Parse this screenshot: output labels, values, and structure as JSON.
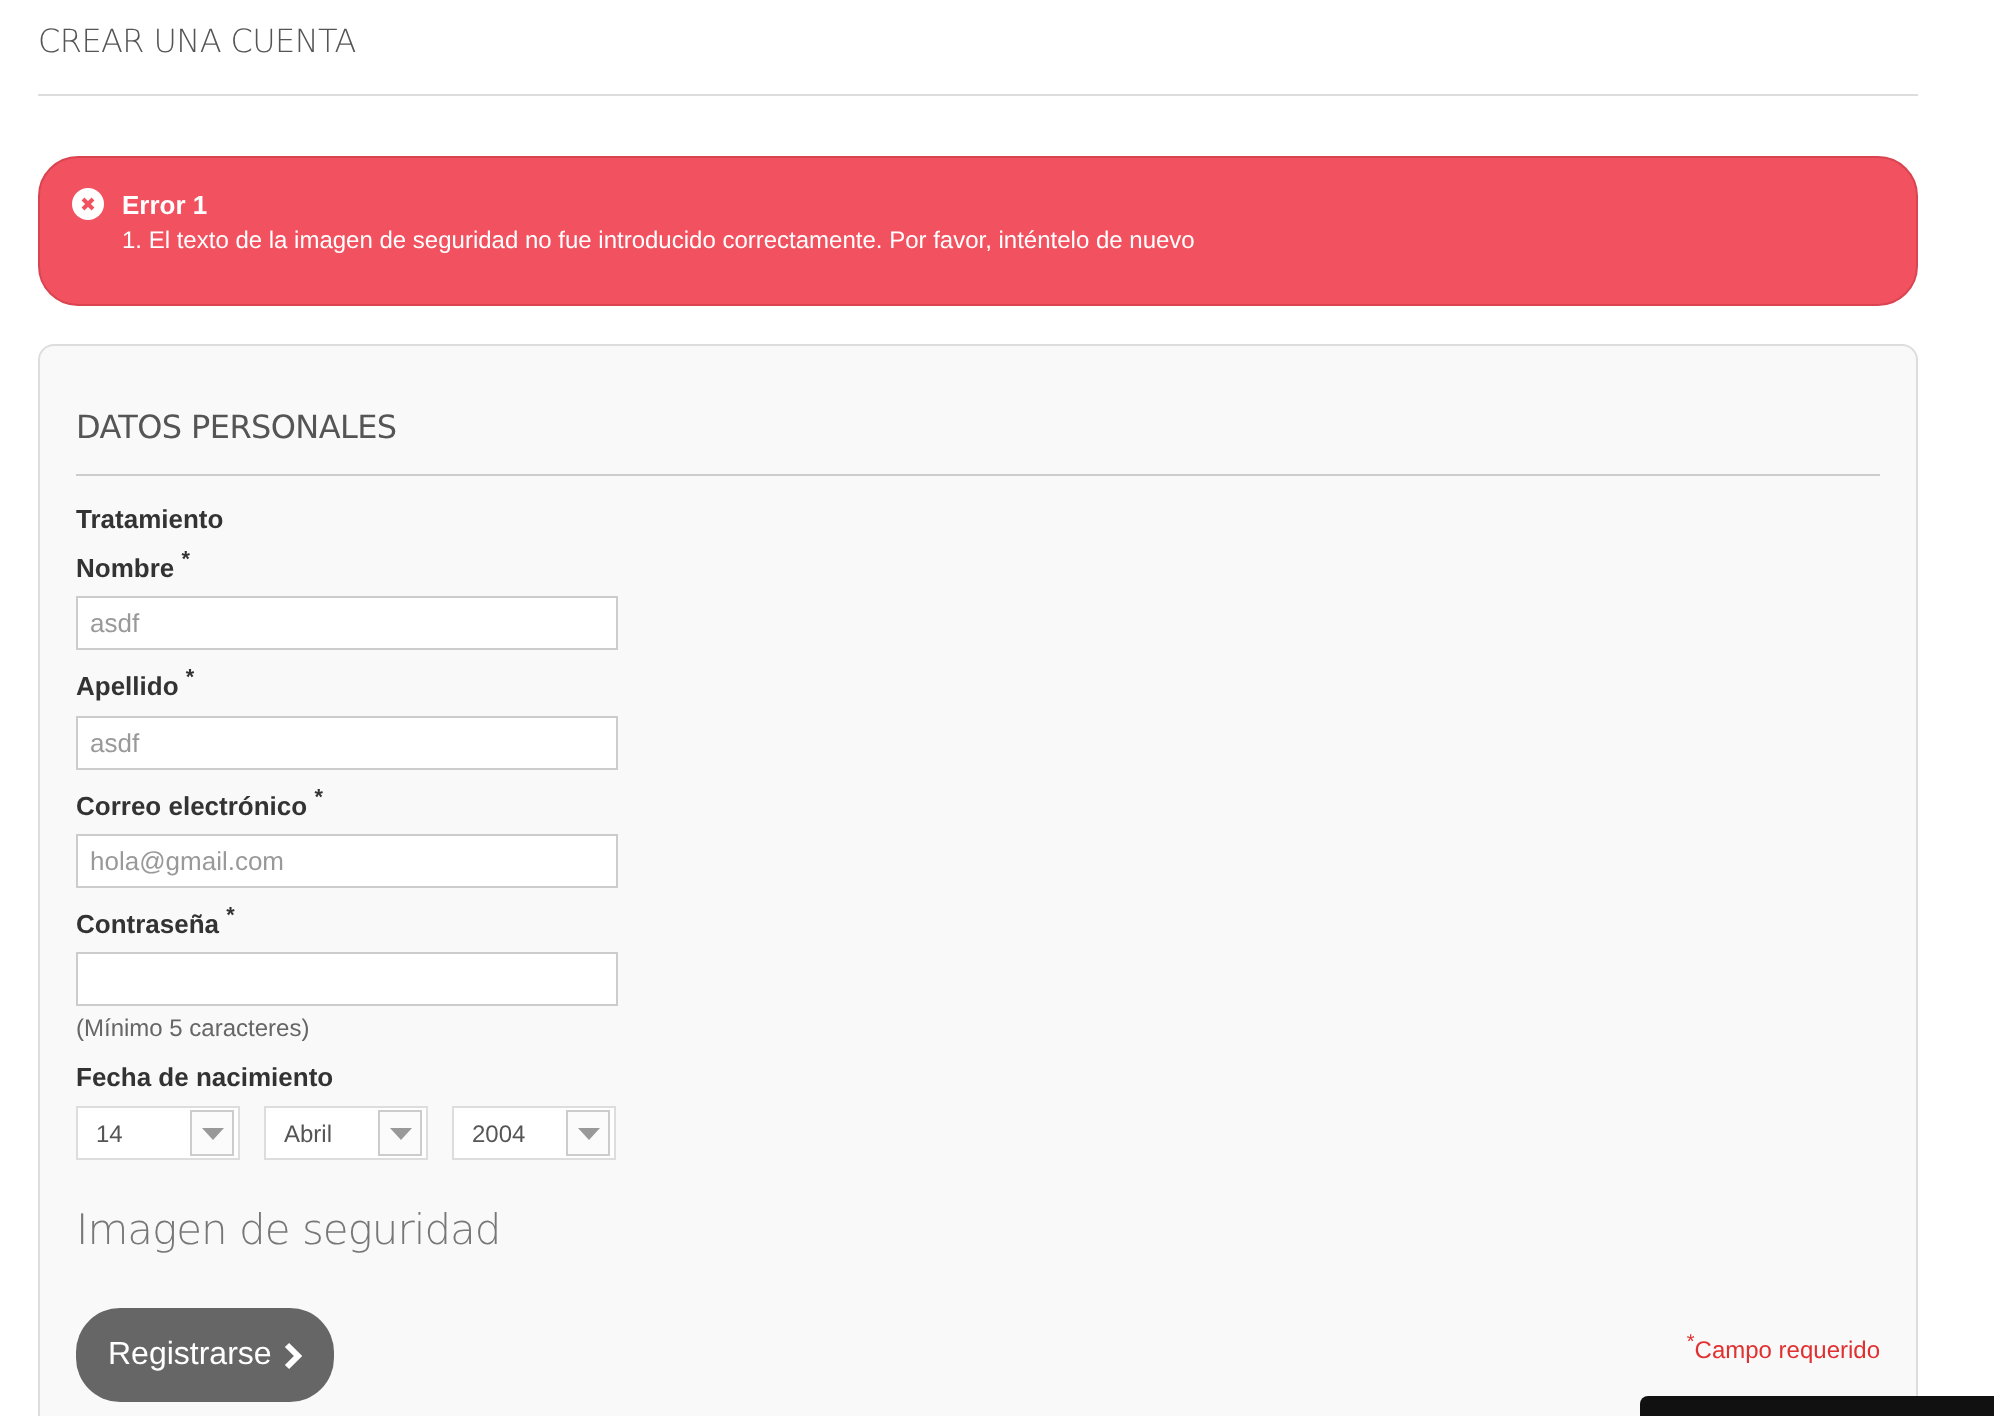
{
  "page_title": "CREAR UNA CUENTA",
  "error": {
    "title": "Error 1",
    "messages": [
      "1. El texto de la imagen de seguridad no fue introducido correctamente. Por favor, inténtelo de nuevo"
    ]
  },
  "form": {
    "section_title": "DATOS PERSONALES",
    "fields": [
      {
        "kind": "label",
        "label": "Tratamiento"
      },
      {
        "kind": "text",
        "label": "Nombre $^{*}$",
        "value": "asdf"
      },
      {
        "kind": "text",
        "label": "Apellido $^{*}$",
        "value": "asdf"
      },
      {
        "kind": "text",
        "label": "Correo electrónico $^{*}$",
        "value": "hola@gmail.com"
      },
      {
        "kind": "password",
        "label": "Contraseña $^{*}$",
        "hint": "(Mínimo 5 caracteres)"
      },
      {
        "kind": "date",
        "label": "Fecha de nacimiento",
        "selects": [
          "14",
          "Abril",
          "2004"
        ]
      }
    ],
    "captcha_title": "Imagen de seguridad",
    "submit": "Registrarse",
    "required_note": "$^{*}$Campo requerido"
  }
}
